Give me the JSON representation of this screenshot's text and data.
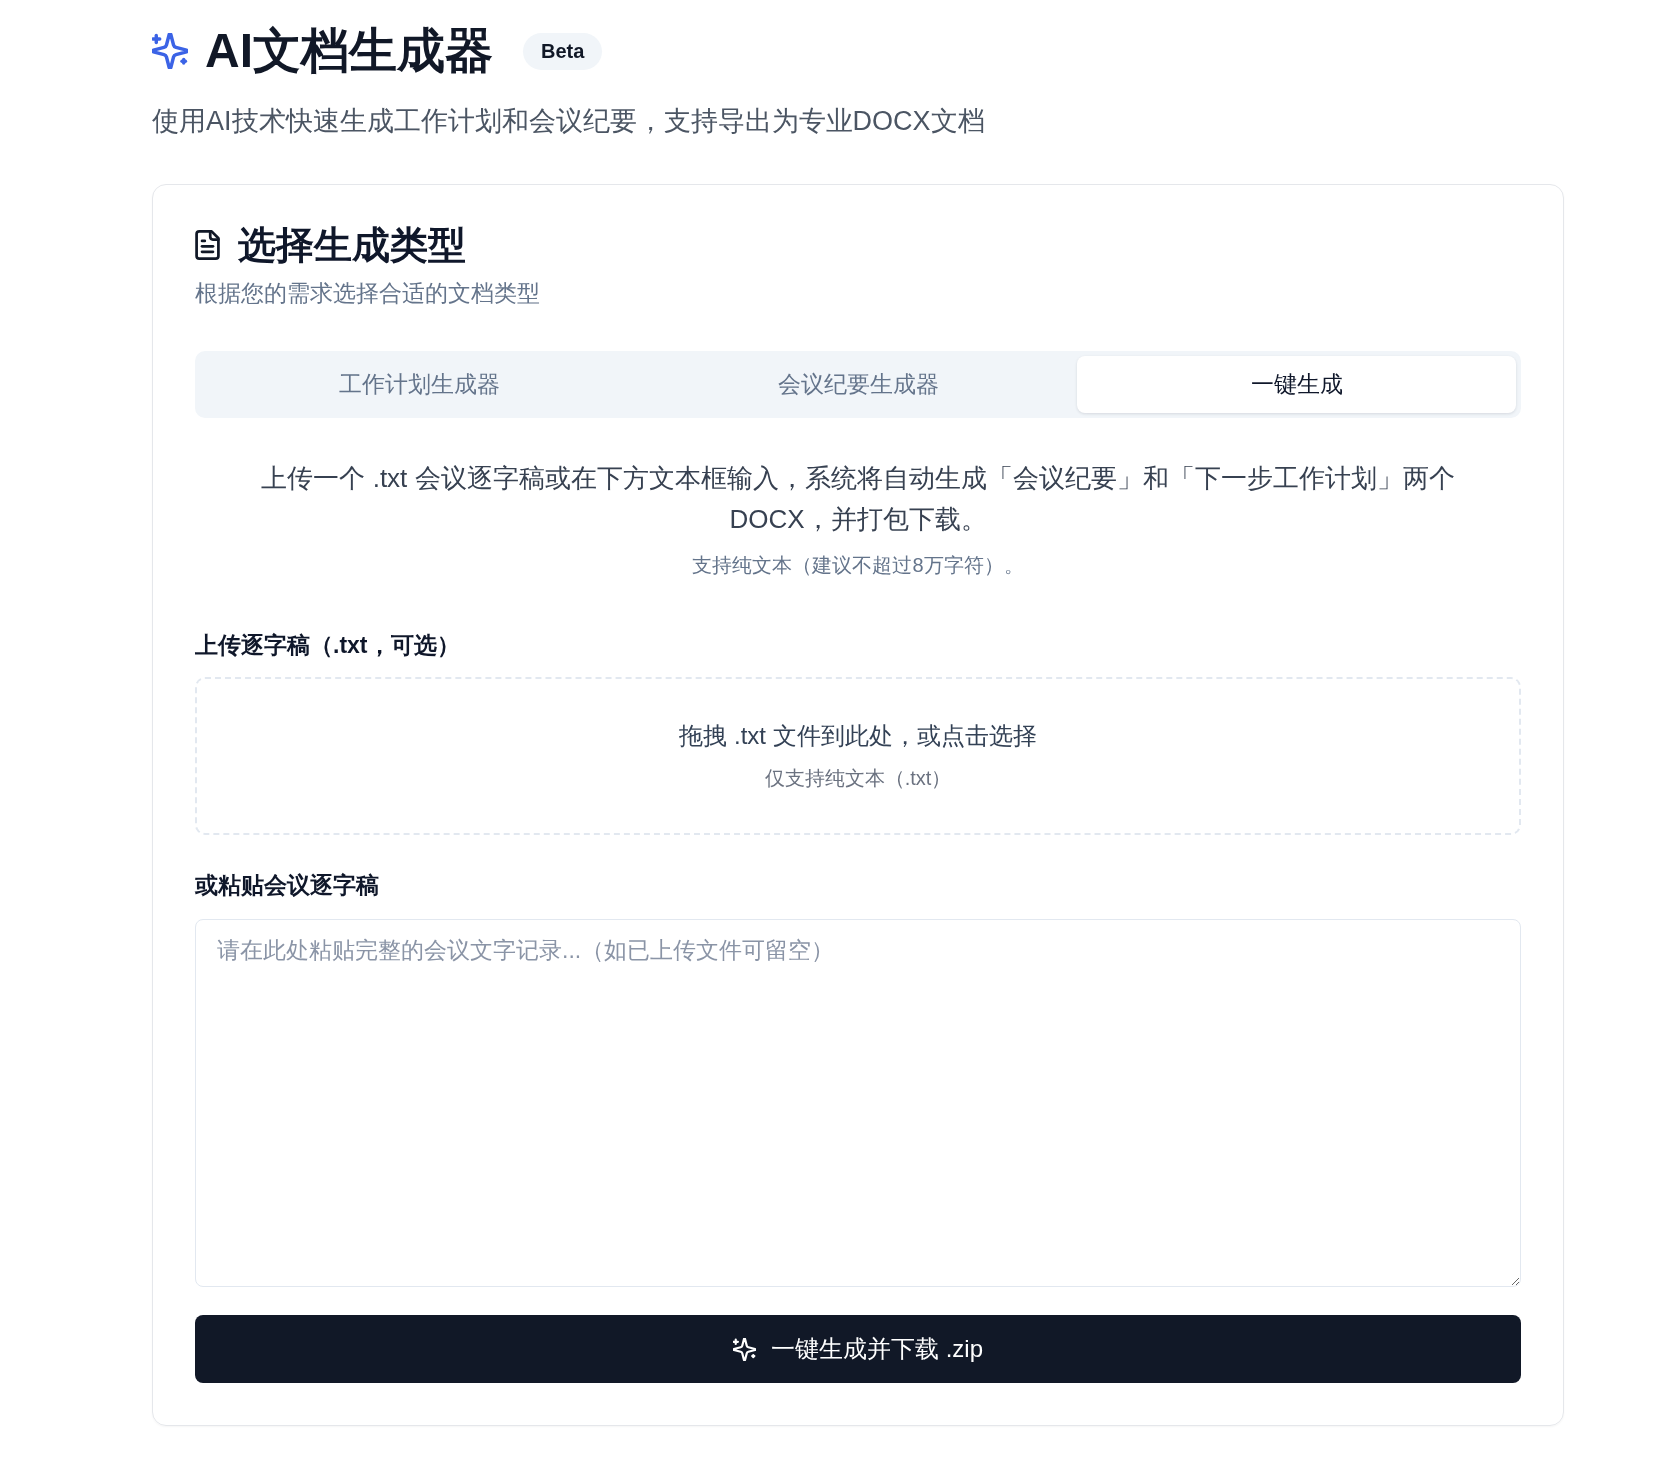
{
  "header": {
    "title": "AI文档生成器",
    "badge": "Beta",
    "subtitle": "使用AI技术快速生成工作计划和会议纪要，支持导出为专业DOCX文档"
  },
  "card": {
    "title": "选择生成类型",
    "subtitle": "根据您的需求选择合适的文档类型",
    "tabs": [
      {
        "label": "工作计划生成器",
        "selected": false
      },
      {
        "label": "会议纪要生成器",
        "selected": false
      },
      {
        "label": "一键生成",
        "selected": true
      }
    ],
    "description": "上传一个 .txt 会议逐字稿或在下方文本框输入，系统将自动生成「会议纪要」和「下一步工作计划」两个 DOCX，并打包下载。",
    "note": "支持纯文本（建议不超过8万字符）。",
    "upload": {
      "label": "上传逐字稿（.txt，可选）",
      "dropzone_text": "拖拽 .txt 文件到此处，或点击选择",
      "dropzone_hint": "仅支持纯文本（.txt）"
    },
    "paste": {
      "label": "或粘贴会议逐字稿",
      "placeholder": "请在此处粘贴完整的会议文字记录...（如已上传文件可留空）"
    },
    "submit_button": "一键生成并下载 .zip"
  }
}
